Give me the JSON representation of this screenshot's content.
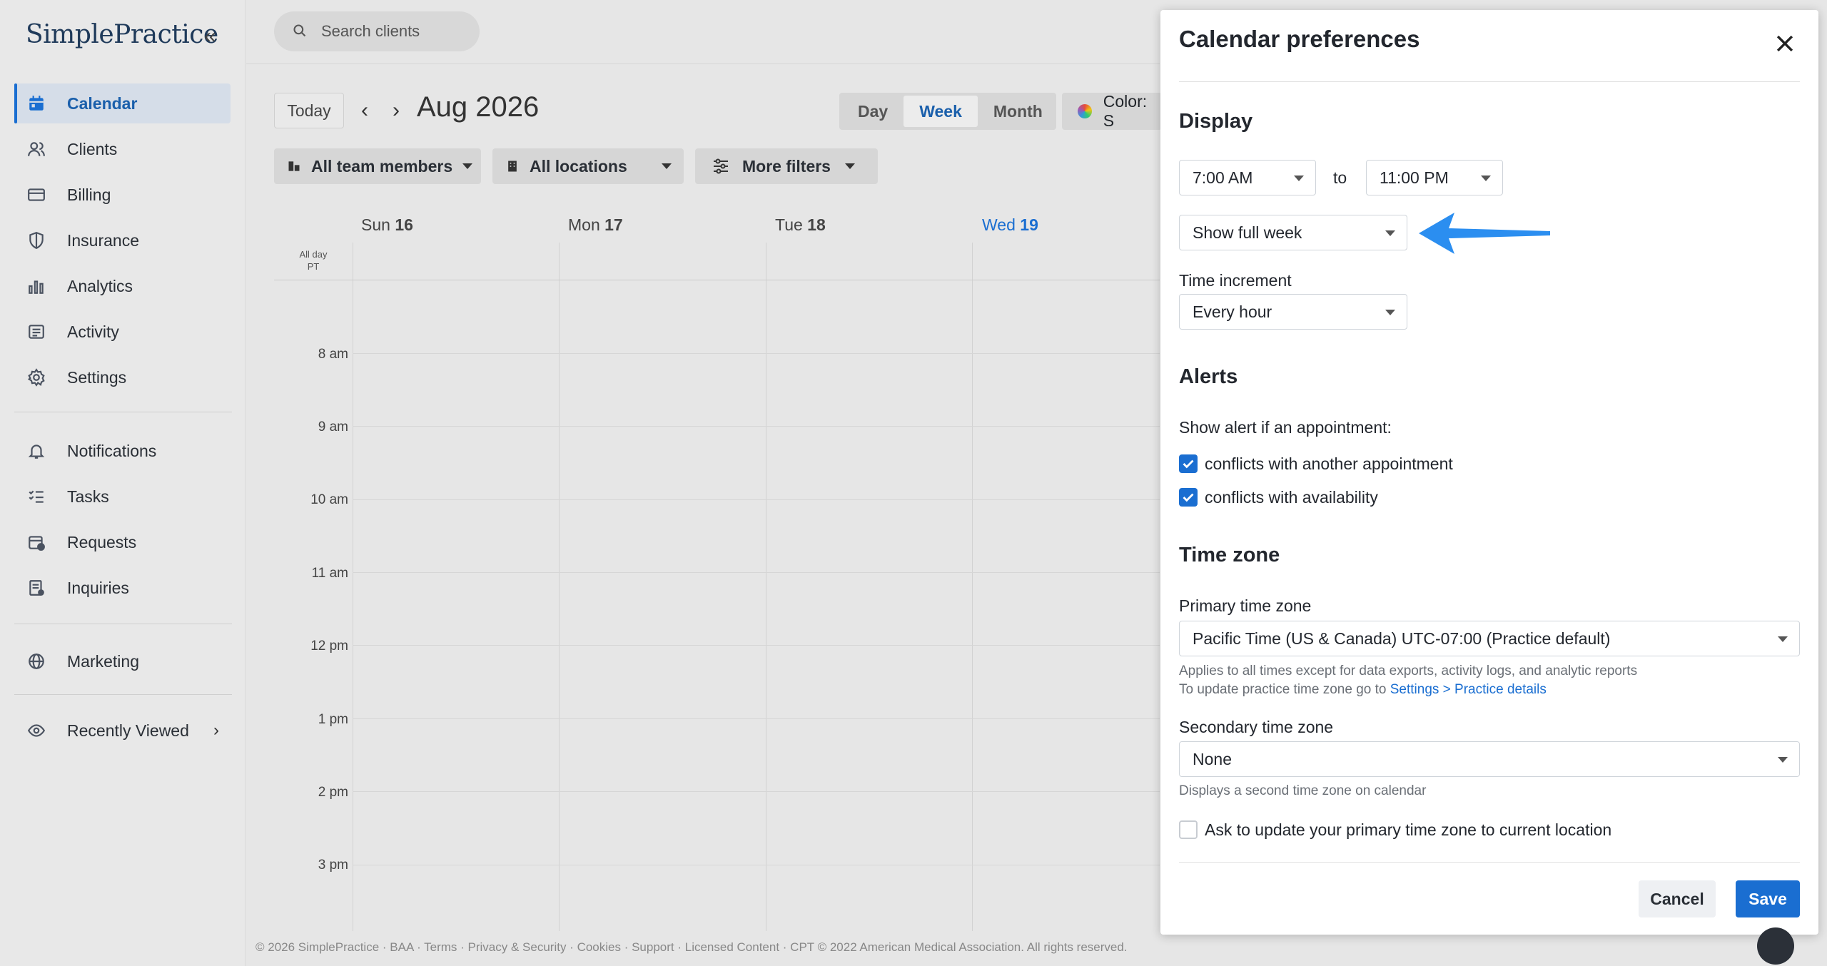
{
  "app": {
    "logo": "SimplePractice"
  },
  "sidebar": {
    "items": [
      {
        "label": "Calendar",
        "icon": "calendar-icon",
        "active": true
      },
      {
        "label": "Clients",
        "icon": "clients-icon"
      },
      {
        "label": "Billing",
        "icon": "billing-icon"
      },
      {
        "label": "Insurance",
        "icon": "shield-icon"
      },
      {
        "label": "Analytics",
        "icon": "analytics-icon"
      },
      {
        "label": "Activity",
        "icon": "activity-icon"
      },
      {
        "label": "Settings",
        "icon": "gear-icon"
      },
      {
        "label": "Notifications",
        "icon": "bell-icon"
      },
      {
        "label": "Tasks",
        "icon": "tasks-icon"
      },
      {
        "label": "Requests",
        "icon": "requests-icon"
      },
      {
        "label": "Inquiries",
        "icon": "inquiries-icon"
      },
      {
        "label": "Marketing",
        "icon": "globe-icon"
      },
      {
        "label": "Recently Viewed",
        "icon": "eye-icon"
      }
    ]
  },
  "search": {
    "placeholder": "Search clients"
  },
  "toolbar": {
    "today": "Today",
    "month_title": "Aug 2026",
    "views": [
      "Day",
      "Week",
      "Month"
    ],
    "active_view": "Week",
    "color_label": "Color: S",
    "filters": {
      "team": "All team members",
      "locations": "All locations",
      "more": "More filters"
    }
  },
  "calendar": {
    "days": [
      {
        "name": "Sun",
        "num": "16"
      },
      {
        "name": "Mon",
        "num": "17"
      },
      {
        "name": "Tue",
        "num": "18"
      },
      {
        "name": "Wed",
        "num": "19",
        "today": true
      }
    ],
    "allday_label": "All day",
    "tz_label": "PT",
    "hours": [
      "8 am",
      "9 am",
      "10 am",
      "11 am",
      "12 pm",
      "1 pm",
      "2 pm",
      "3 pm"
    ]
  },
  "footer": {
    "text": "© 2026 SimplePractice · BAA · Terms · Privacy & Security · Cookies · Support · Licensed Content · CPT © 2022 American Medical Association. All rights reserved."
  },
  "drawer": {
    "title": "Calendar preferences",
    "display": {
      "heading": "Display",
      "start_time": "7:00 AM",
      "to": "to",
      "end_time": "11:00 PM",
      "week_mode": "Show full week",
      "increment_label": "Time increment",
      "increment_value": "Every hour"
    },
    "alerts": {
      "heading": "Alerts",
      "subheading": "Show alert if an appointment:",
      "conflict_appt": "conflicts with another appointment",
      "conflict_avail": "conflicts with availability"
    },
    "timezone": {
      "heading": "Time zone",
      "primary_label": "Primary time zone",
      "primary_value": "Pacific Time (US & Canada) UTC-07:00 (Practice default)",
      "help1": "Applies to all times except for data exports, activity logs, and analytic reports",
      "help2_prefix": "To update practice time zone go to ",
      "help2_link": "Settings > Practice details",
      "secondary_label": "Secondary time zone",
      "secondary_value": "None",
      "secondary_help": "Displays a second time zone on calendar",
      "ask_update": "Ask to update your primary time zone to current location"
    },
    "cancel": "Cancel",
    "save": "Save"
  },
  "colors": {
    "accent": "#1a6ed1",
    "annotation_arrow": "#2b8ef0"
  }
}
